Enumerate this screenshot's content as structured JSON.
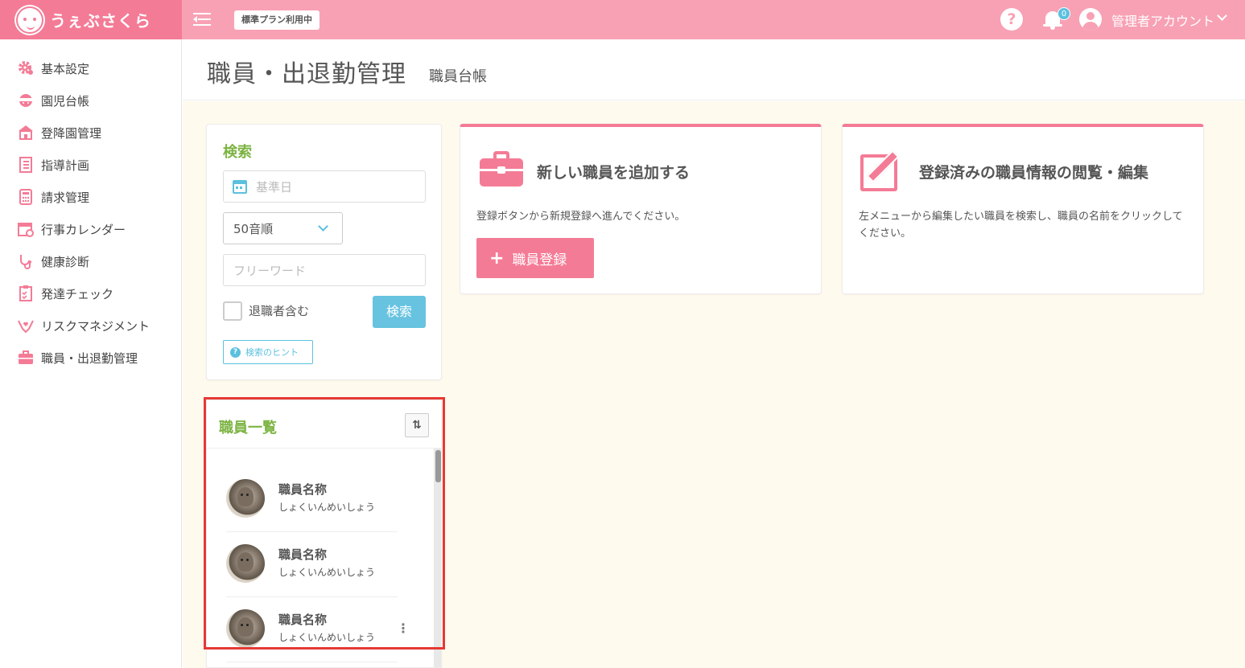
{
  "app": {
    "logo_text": "うぇぶさくら",
    "plan_badge": "標準プラン利用中"
  },
  "header": {
    "notification_count": "0",
    "account_name": "管理者アカウント"
  },
  "sidebar": {
    "items": [
      {
        "label": "基本設定",
        "icon": "gear-icon"
      },
      {
        "label": "園児台帳",
        "icon": "child-icon"
      },
      {
        "label": "登降園管理",
        "icon": "school-icon"
      },
      {
        "label": "指導計画",
        "icon": "notebook-icon"
      },
      {
        "label": "請求管理",
        "icon": "calculator-icon"
      },
      {
        "label": "行事カレンダー",
        "icon": "calendar-icon"
      },
      {
        "label": "健康診断",
        "icon": "stethoscope-icon"
      },
      {
        "label": "発達チェック",
        "icon": "checklist-icon"
      },
      {
        "label": "リスクマネジメント",
        "icon": "hands-heart-icon"
      },
      {
        "label": "職員・出退勤管理",
        "icon": "briefcase-icon"
      }
    ]
  },
  "page": {
    "title": "職員・出退勤管理",
    "subtitle": "職員台帳"
  },
  "search": {
    "title": "検索",
    "date_placeholder": "基準日",
    "order_value": "50音順",
    "freeword_placeholder": "フリーワード",
    "include_retired_label": "退職者含む",
    "search_button": "検索",
    "hint_button": "検索のヒント"
  },
  "staff_list": {
    "title": "職員一覧",
    "sort_symbol": "⇅",
    "items": [
      {
        "name": "職員名称",
        "kana": "しょくいんめいしょう"
      },
      {
        "name": "職員名称",
        "kana": "しょくいんめいしょう"
      },
      {
        "name": "職員名称",
        "kana": "しょくいんめいしょう"
      }
    ],
    "more_symbol": "⋮"
  },
  "add_card": {
    "title": "新しい職員を追加する",
    "description": "登録ボタンから新規登録へ進んでください。",
    "button": "職員登録",
    "button_plus": "+"
  },
  "edit_card": {
    "title": "登録済みの職員情報の閲覧・編集",
    "description": "左メニューから編集したい職員を検索し、職員の名前をクリックしてください。"
  },
  "colors": {
    "brand_pink": "#f47b96",
    "header_pink": "#f8a1b4",
    "accent_blue": "#5bc0de",
    "section_green": "#7cb342",
    "highlight_red": "#e53935"
  }
}
